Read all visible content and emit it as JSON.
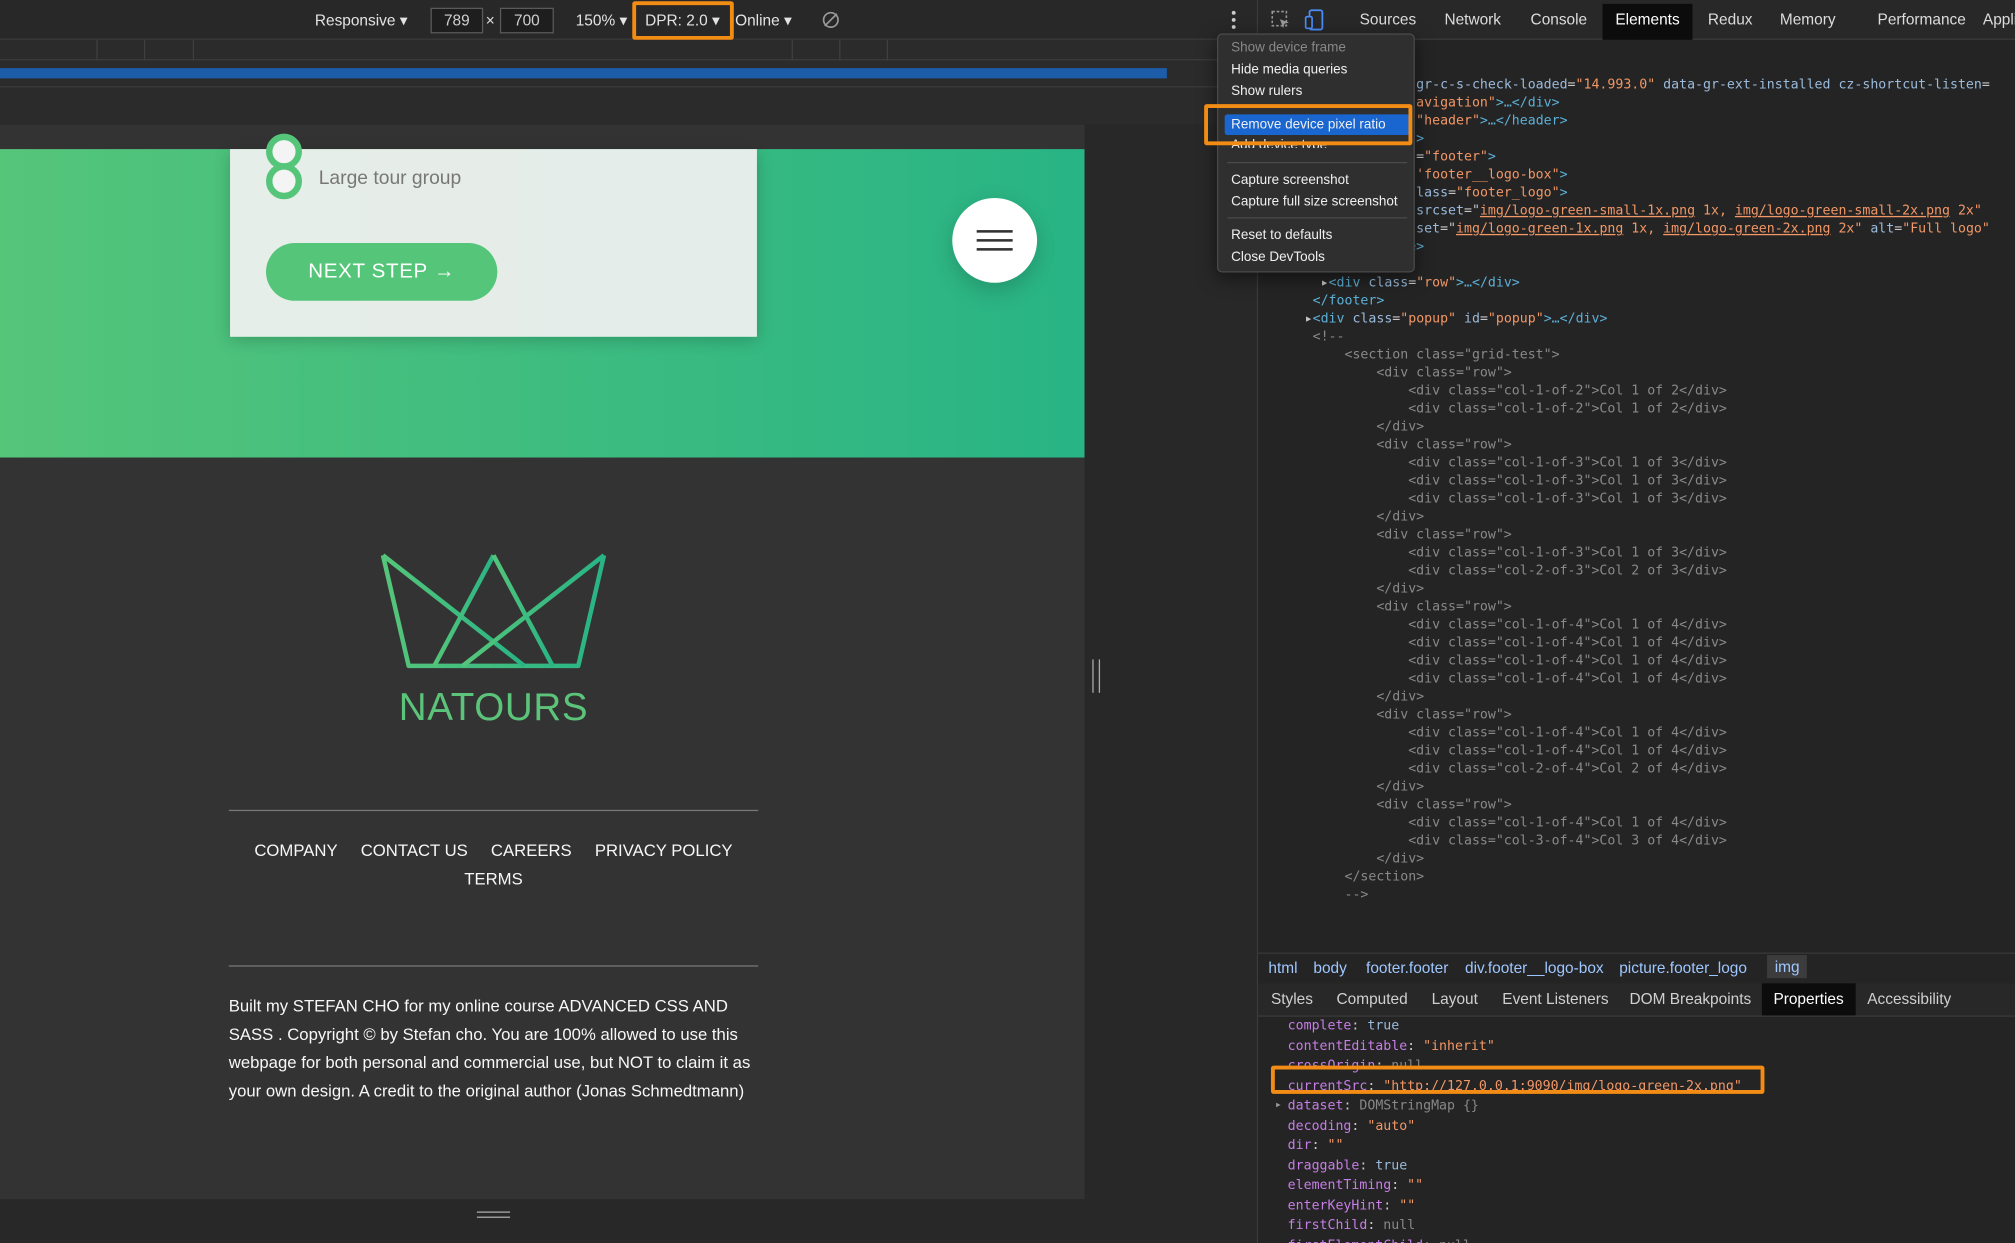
{
  "device_toolbar": {
    "mode": "Responsive",
    "width": "789",
    "times": "×",
    "height": "700",
    "zoom": "150%",
    "dpr": "DPR: 2.0",
    "network": "Online"
  },
  "page": {
    "radio_option": "Large tour group",
    "next_button": "NEXT STEP →",
    "logo_text": "NATOURS",
    "footer_nav": [
      "COMPANY",
      "CONTACT US",
      "CAREERS",
      "PRIVACY POLICY",
      "TERMS"
    ],
    "copyright": "Built my STEFAN CHO for my online course ADVANCED CSS AND SASS . Copyright © by Stefan cho. You are 100% allowed to use this webpage for both personal and commercial use, but NOT to claim it as your own design. A credit to the original author (Jonas Schmedtmann)"
  },
  "devtools": {
    "tabs": [
      "Sources",
      "Network",
      "Console",
      "Elements",
      "Redux",
      "Memory",
      "Performance",
      "Appli"
    ],
    "selected_tab": "Elements",
    "code_lines": [
      {
        "indent": "",
        "parts": [
          [
            "t",
            ""
          ]
        ]
      },
      {
        "indent": "",
        "parts": [
          [
            "t",
            ""
          ]
        ]
      },
      {
        "indent": "",
        "parts": [
          [
            "a",
            "gr-c-s-check-loaded"
          ],
          [
            "t",
            "="
          ],
          [
            "v",
            "\"14.993.0\""
          ],
          [
            "t",
            " "
          ],
          [
            "a",
            "data-gr-ext-installed"
          ],
          [
            "t",
            " "
          ],
          [
            "a",
            "cz-shortcut-listen"
          ],
          [
            "t",
            "="
          ]
        ]
      },
      {
        "indent": "",
        "parts": [
          [
            "v",
            "avigation\""
          ],
          [
            "g",
            ">…</div>"
          ]
        ]
      },
      {
        "indent": "",
        "parts": [
          [
            "v",
            "\"header\""
          ],
          [
            "g",
            ">…</header>"
          ]
        ]
      },
      {
        "indent": "",
        "parts": [
          [
            "g",
            ">"
          ]
        ]
      },
      {
        "indent": "",
        "parts": [
          [
            "t",
            "="
          ],
          [
            "v",
            "\"footer\""
          ],
          [
            "g",
            ">"
          ]
        ]
      },
      {
        "indent": "",
        "parts": [
          [
            "v",
            "'footer__logo-box\""
          ],
          [
            "g",
            ">"
          ]
        ]
      },
      {
        "indent": "",
        "parts": [
          [
            "a",
            "lass"
          ],
          [
            "t",
            "="
          ],
          [
            "v",
            "\"footer_logo\""
          ],
          [
            "g",
            ">"
          ]
        ]
      },
      {
        "indent": "",
        "parts": [
          [
            "a",
            "srcset"
          ],
          [
            "t",
            "=\""
          ],
          [
            "u",
            "img/logo-green-small-1x.png"
          ],
          [
            "v",
            " 1x, "
          ],
          [
            "u",
            "img/logo-green-small-2x.png"
          ],
          [
            "v",
            " 2x\""
          ]
        ]
      },
      {
        "indent": "",
        "parts": [
          [
            "a",
            "set"
          ],
          [
            "t",
            "=\""
          ],
          [
            "u",
            "img/logo-green-1x.png"
          ],
          [
            "v",
            " 1x, "
          ],
          [
            "u",
            "img/logo-green-2x.png"
          ],
          [
            "v",
            " 2x\""
          ],
          [
            "t",
            " "
          ],
          [
            "a",
            "alt"
          ],
          [
            "t",
            "="
          ],
          [
            "v",
            "\"Full logo\""
          ]
        ]
      },
      {
        "indent": "      ",
        "parts": [
          [
            "g",
            "</picture>"
          ]
        ]
      },
      {
        "indent": "    ",
        "parts": [
          [
            "g",
            "</div>"
          ]
        ]
      },
      {
        "indent": "   ▸",
        "parts": [
          [
            "g",
            "<div "
          ],
          [
            "a",
            "class"
          ],
          [
            "t",
            "="
          ],
          [
            "v",
            "\"row\""
          ],
          [
            "g",
            ">…</div>"
          ]
        ]
      },
      {
        "indent": "  ",
        "parts": [
          [
            "g",
            "</footer>"
          ]
        ]
      },
      {
        "indent": " ▸",
        "parts": [
          [
            "g",
            "<div "
          ],
          [
            "a",
            "class"
          ],
          [
            "t",
            "="
          ],
          [
            "v",
            "\"popup\""
          ],
          [
            "t",
            " "
          ],
          [
            "a",
            "id"
          ],
          [
            "t",
            "="
          ],
          [
            "v",
            "\"popup\""
          ],
          [
            "g",
            ">…</div>"
          ]
        ]
      },
      {
        "indent": "  ",
        "parts": [
          [
            "c",
            "<!--"
          ]
        ]
      },
      {
        "indent": "      ",
        "parts": [
          [
            "c",
            "<section class=\"grid-test\">"
          ]
        ]
      },
      {
        "indent": "          ",
        "parts": [
          [
            "c",
            "<div class=\"row\">"
          ]
        ]
      },
      {
        "indent": "              ",
        "parts": [
          [
            "c",
            "<div class=\"col-1-of-2\">Col 1 of 2</div>"
          ]
        ]
      },
      {
        "indent": "              ",
        "parts": [
          [
            "c",
            "<div class=\"col-1-of-2\">Col 1 of 2</div>"
          ]
        ]
      },
      {
        "indent": "          ",
        "parts": [
          [
            "c",
            "</div>"
          ]
        ]
      },
      {
        "indent": "          ",
        "parts": [
          [
            "c",
            "<div class=\"row\">"
          ]
        ]
      },
      {
        "indent": "              ",
        "parts": [
          [
            "c",
            "<div class=\"col-1-of-3\">Col 1 of 3</div>"
          ]
        ]
      },
      {
        "indent": "              ",
        "parts": [
          [
            "c",
            "<div class=\"col-1-of-3\">Col 1 of 3</div>"
          ]
        ]
      },
      {
        "indent": "              ",
        "parts": [
          [
            "c",
            "<div class=\"col-1-of-3\">Col 1 of 3</div>"
          ]
        ]
      },
      {
        "indent": "          ",
        "parts": [
          [
            "c",
            "</div>"
          ]
        ]
      },
      {
        "indent": "          ",
        "parts": [
          [
            "c",
            "<div class=\"row\">"
          ]
        ]
      },
      {
        "indent": "              ",
        "parts": [
          [
            "c",
            "<div class=\"col-1-of-3\">Col 1 of 3</div>"
          ]
        ]
      },
      {
        "indent": "              ",
        "parts": [
          [
            "c",
            "<div class=\"col-2-of-3\">Col 2 of 3</div>"
          ]
        ]
      },
      {
        "indent": "          ",
        "parts": [
          [
            "c",
            "</div>"
          ]
        ]
      },
      {
        "indent": "          ",
        "parts": [
          [
            "c",
            "<div class=\"row\">"
          ]
        ]
      },
      {
        "indent": "              ",
        "parts": [
          [
            "c",
            "<div class=\"col-1-of-4\">Col 1 of 4</div>"
          ]
        ]
      },
      {
        "indent": "              ",
        "parts": [
          [
            "c",
            "<div class=\"col-1-of-4\">Col 1 of 4</div>"
          ]
        ]
      },
      {
        "indent": "              ",
        "parts": [
          [
            "c",
            "<div class=\"col-1-of-4\">Col 1 of 4</div>"
          ]
        ]
      },
      {
        "indent": "              ",
        "parts": [
          [
            "c",
            "<div class=\"col-1-of-4\">Col 1 of 4</div>"
          ]
        ]
      },
      {
        "indent": "          ",
        "parts": [
          [
            "c",
            "</div>"
          ]
        ]
      },
      {
        "indent": "          ",
        "parts": [
          [
            "c",
            "<div class=\"row\">"
          ]
        ]
      },
      {
        "indent": "              ",
        "parts": [
          [
            "c",
            "<div class=\"col-1-of-4\">Col 1 of 4</div>"
          ]
        ]
      },
      {
        "indent": "              ",
        "parts": [
          [
            "c",
            "<div class=\"col-1-of-4\">Col 1 of 4</div>"
          ]
        ]
      },
      {
        "indent": "              ",
        "parts": [
          [
            "c",
            "<div class=\"col-2-of-4\">Col 2 of 4</div>"
          ]
        ]
      },
      {
        "indent": "          ",
        "parts": [
          [
            "c",
            "</div>"
          ]
        ]
      },
      {
        "indent": "          ",
        "parts": [
          [
            "c",
            "<div class=\"row\">"
          ]
        ]
      },
      {
        "indent": "              ",
        "parts": [
          [
            "c",
            "<div class=\"col-1-of-4\">Col 1 of 4</div>"
          ]
        ]
      },
      {
        "indent": "              ",
        "parts": [
          [
            "c",
            "<div class=\"col-3-of-4\">Col 3 of 4</div>"
          ]
        ]
      },
      {
        "indent": "          ",
        "parts": [
          [
            "c",
            "</div>"
          ]
        ]
      },
      {
        "indent": "      ",
        "parts": [
          [
            "c",
            "</section>"
          ]
        ]
      },
      {
        "indent": "      ",
        "parts": [
          [
            "c",
            "-->"
          ]
        ]
      }
    ],
    "breadcrumbs": [
      "html",
      "body",
      "footer.footer",
      "div.footer__logo-box",
      "picture.footer_logo",
      "img"
    ],
    "panel_tabs": [
      "Styles",
      "Computed",
      "Layout",
      "Event Listeners",
      "DOM Breakpoints",
      "Properties",
      "Accessibility"
    ],
    "selected_panel_tab": "Properties",
    "properties": [
      {
        "key": "complete",
        "value": "true",
        "kind": "n"
      },
      {
        "key": "contentEditable",
        "value": "\"inherit\"",
        "kind": "s"
      },
      {
        "key": "crossOrigin",
        "value": "null",
        "kind": "g"
      },
      {
        "key": "currentSrc",
        "value": "\"http://127.0.0.1:9090/img/logo-green-2x.png\"",
        "kind": "s"
      },
      {
        "key": "dataset",
        "value": "DOMStringMap {}",
        "kind": "g",
        "expand": true
      },
      {
        "key": "decoding",
        "value": "\"auto\"",
        "kind": "s"
      },
      {
        "key": "dir",
        "value": "\"\"",
        "kind": "s"
      },
      {
        "key": "draggable",
        "value": "true",
        "kind": "n"
      },
      {
        "key": "elementTiming",
        "value": "\"\"",
        "kind": "s"
      },
      {
        "key": "enterKeyHint",
        "value": "\"\"",
        "kind": "s"
      },
      {
        "key": "firstChild",
        "value": "null",
        "kind": "g"
      },
      {
        "key": "firstElementChild",
        "value": "null",
        "kind": "g"
      }
    ]
  },
  "context_menu": {
    "items": [
      {
        "label": "Show device frame",
        "disabled": true
      },
      {
        "label": "Hide media queries"
      },
      {
        "label": "Show rulers"
      },
      {
        "label": "Remove device pixel ratio",
        "selected": true
      },
      {
        "label": "Add device type"
      },
      {
        "label": "Capture screenshot"
      },
      {
        "label": "Capture full size screenshot"
      },
      {
        "label": "Reset to defaults"
      },
      {
        "label": "Close DevTools"
      }
    ]
  },
  "colors": {
    "highlight": "#f28c14",
    "brand_green": "#55c57a",
    "brand_green_dark": "#28b485",
    "menu_selected": "#1a66d0"
  }
}
